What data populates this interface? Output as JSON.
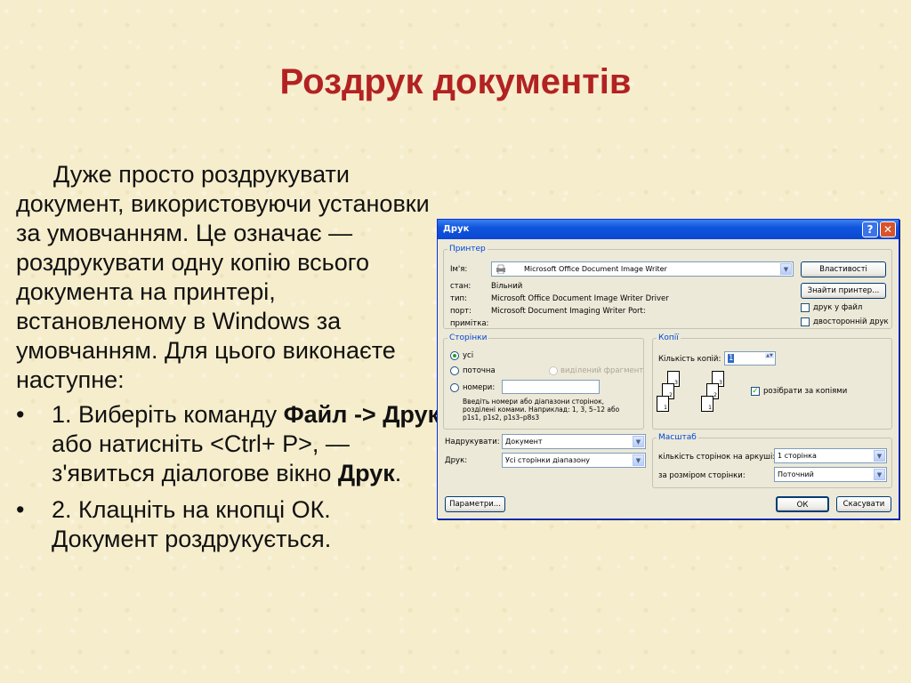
{
  "slide": {
    "title": "Роздрук документів",
    "intro": "Дуже просто роздрукувати документ, використовуючи установки за умовчанням. Це означає — роздрукувати одну копію всього документа на принтері, встановленому в Windows за умовчанням. Для цього виконаєте наступне:",
    "bullet_glyph": "•",
    "bullet1": {
      "p1": "1. Виберіть команду ",
      "b1": "Файл -> Друк",
      "p2": " або натисніть <Ctrl+ P>, — з'явиться діалогове вікно ",
      "b2": "Друк",
      "p3": "."
    },
    "bullet2": "2. Клацніть на кнопці ОК. Документ роздрукується."
  },
  "dialog": {
    "title": "Друк",
    "help_glyph": "?",
    "close_glyph": "✕",
    "printer": {
      "legend": "Принтер",
      "name_label": "Ім'я:",
      "name_value": "Microsoft Office Document Image Writer",
      "status_label": "стан:",
      "status_value": "Вільний",
      "type_label": "тип:",
      "type_value": "Microsoft Office Document Image Writer Driver",
      "port_label": "порт:",
      "port_value": "Microsoft Document Imaging Writer Port:",
      "comment_label": "примітка:",
      "properties_button": "Властивості",
      "find_button": "Знайти принтер...",
      "print_to_file": "друк у файл",
      "duplex": "двосторонній друк"
    },
    "pages": {
      "legend": "Сторінки",
      "all": "усі",
      "current": "поточна",
      "selection": "виділений фрагмент",
      "numbers": "номери:",
      "hint": "Введіть номери або діапазони сторінок, розділені комами. Наприклад: 1, 3, 5–12 або p1s1, p1s2, p1s3–p8s3"
    },
    "copies": {
      "legend": "Копії",
      "count_label": "Кількість копій:",
      "count_value": "1",
      "collate": "розібрати за копіями",
      "page_labels": [
        "3",
        "2",
        "1",
        "3",
        "2",
        "1"
      ]
    },
    "print_what_label": "Надрукувати:",
    "print_what_value": "Документ",
    "print_label": "Друк:",
    "print_value": "Усі сторінки діапазону",
    "zoom": {
      "legend": "Масштаб",
      "pages_per_sheet_label": "кількість сторінок на аркуші:",
      "pages_per_sheet_value": "1 сторінка",
      "scale_label": "за розміром сторінки:",
      "scale_value": "Поточний"
    },
    "options_button": "Параметри...",
    "ok_button": "ОК",
    "cancel_button": "Скасувати",
    "dropdown_glyph": "▼",
    "spin_glyph": "▲▼",
    "check_glyph": "✓"
  }
}
